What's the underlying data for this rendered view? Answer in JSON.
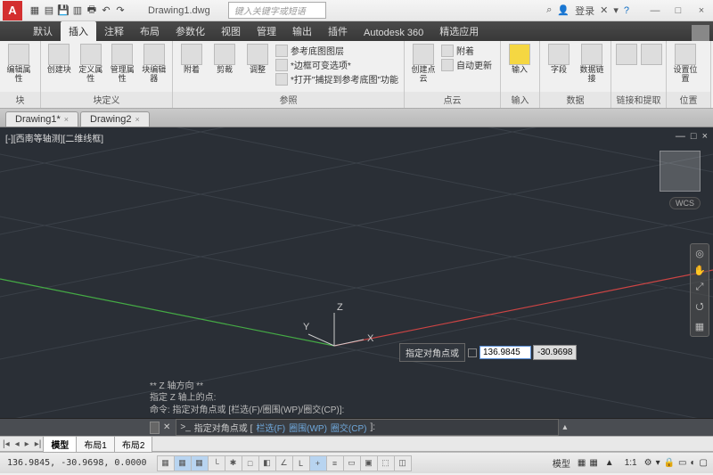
{
  "titlebar": {
    "logo": "A",
    "doc_title": "Drawing1.dwg",
    "search_placeholder": "键入关键字或短语",
    "login": "登录",
    "win_min": "—",
    "win_max": "□",
    "win_close": "×"
  },
  "ribbon_tabs": [
    "默认",
    "插入",
    "注释",
    "布局",
    "参数化",
    "视图",
    "管理",
    "输出",
    "插件",
    "Autodesk 360",
    "精选应用"
  ],
  "ribbon_active_tab": 1,
  "ribbon": {
    "panels": [
      {
        "label": "块",
        "items": [
          {
            "t": "编辑属性"
          }
        ]
      },
      {
        "label": "块定义",
        "items": [
          {
            "t": "创建块"
          },
          {
            "t": "定义属性"
          },
          {
            "t": "管理属性"
          },
          {
            "t": "块编辑器"
          }
        ]
      },
      {
        "label": "参照",
        "big": [
          {
            "t": "附着"
          },
          {
            "t": "剪裁"
          },
          {
            "t": "调整"
          }
        ],
        "rows": [
          "参考底图图层",
          "*边框可变选项*",
          "*打开\"捕捉到参考底图\"功能"
        ]
      },
      {
        "label": "点云",
        "big": [
          {
            "t": "创建点云"
          }
        ],
        "rows": [
          "附着",
          "自动更新"
        ]
      },
      {
        "label": "输入",
        "items": [
          {
            "t": "输入"
          }
        ]
      },
      {
        "label": "数据",
        "big": [
          {
            "t": "字段"
          }
        ],
        "rows": [
          "数据链接"
        ]
      },
      {
        "label": "链接和提取",
        "items": []
      },
      {
        "label": "位置",
        "items": [
          {
            "t": "设置位置"
          }
        ]
      }
    ]
  },
  "doc_tabs": [
    {
      "name": "Drawing1*",
      "close": "×"
    },
    {
      "name": "Drawing2",
      "close": "×"
    }
  ],
  "viewport": {
    "label": "[-][西南等轴测][二维线框]",
    "wcs": "WCS",
    "ucs": {
      "x": "X",
      "y": "Y",
      "z": "Z"
    },
    "dyn_label": "指定对角点或",
    "dyn_v1": "136.9845",
    "dyn_v2": "-30.9698",
    "hist": [
      "** Z 轴方向 **",
      "指定 Z 轴上的点:",
      "命令: 指定对角点或 [栏选(F)/圈围(WP)/圈交(CP)]:"
    ]
  },
  "cmdline": {
    "prefix": ">_",
    "text": "指定对角点或 [",
    "opts": [
      "栏选(F)",
      "圈围(WP)",
      "圈交(CP)"
    ],
    "suffix": "]:"
  },
  "layout_tabs": [
    "模型",
    "布局1",
    "布局2"
  ],
  "layout_active": 0,
  "statusbar": {
    "coords": "136.9845, -30.9698, 0.0000",
    "model": "模型",
    "scale": "1:1",
    "anno": "▲"
  }
}
